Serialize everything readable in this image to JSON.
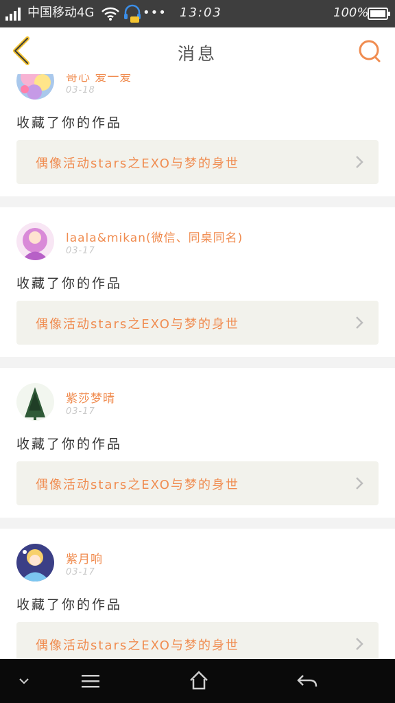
{
  "status": {
    "carrier": "中国移动4G",
    "dots": "•••",
    "time": "13:03",
    "battery": "100%"
  },
  "header": {
    "title": "消息",
    "back_icon": "chevron-left-icon",
    "search_icon": "search-icon"
  },
  "messages": [
    {
      "user": "哥心  爱一爱",
      "date": "03-18",
      "action": "收藏了你的作品",
      "work": "偶像活动stars之EXO与梦的身世"
    },
    {
      "user": "laala&mikan(微信、同桌同名)",
      "date": "03-17",
      "action": "收藏了你的作品",
      "work": "偶像活动stars之EXO与梦的身世"
    },
    {
      "user": "紫莎梦晴",
      "date": "03-17",
      "action": "收藏了你的作品",
      "work": "偶像活动stars之EXO与梦的身世"
    },
    {
      "user": "紫月响",
      "date": "03-17",
      "action": "收藏了你的作品",
      "work": "偶像活动stars之EXO与梦的身世"
    }
  ],
  "colors": {
    "accent": "#f08c50",
    "statusbar": "#3e3e3e",
    "navbar_bottom": "#0a0a0a",
    "work_bg": "#f2f2ec"
  },
  "nav_buttons": [
    "chevron-down-icon",
    "menu-icon",
    "home-icon",
    "back-arrow-icon"
  ]
}
